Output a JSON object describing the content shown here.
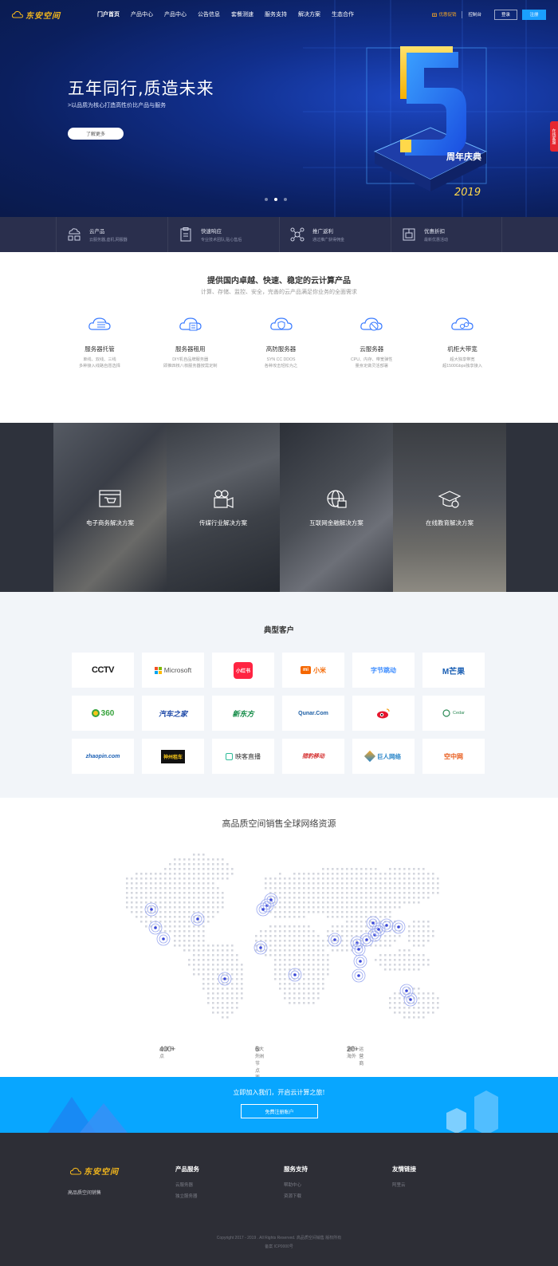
{
  "nav": {
    "logo_text": "东安空间",
    "items": [
      "门户首页",
      "产品中心",
      "产品中心",
      "公告信息",
      "套餐测速",
      "服务支持",
      "解决方案",
      "生态合作"
    ],
    "promo": "优惠促销",
    "console": "控制台",
    "login": "登录",
    "register": "注册"
  },
  "hero": {
    "title": "五年同行,质造未来",
    "subtitle": ">以品质为核心打造高性价比产品与服务",
    "button": "了解更多",
    "badge_year": "2019",
    "badge_text": "周年庆典",
    "side_tag": "在线客服"
  },
  "strip": [
    {
      "title": "云产品",
      "desc": "云服务器,虚机,网服器",
      "icon": "cloud-product-icon"
    },
    {
      "title": "快速响应",
      "desc": "专业技术团队,贴心售后",
      "icon": "fast-response-icon"
    },
    {
      "title": "推广返利",
      "desc": "通过推广获得佣金",
      "icon": "promotion-icon"
    },
    {
      "title": "优惠折扣",
      "desc": "最新优惠活动",
      "icon": "discount-icon"
    }
  ],
  "products": {
    "title": "提供国内卓越、快速、稳定的云计算产品",
    "subtitle": "计算、存储、监控、安全，完善的云产品满足你业务的全面需求",
    "items": [
      {
        "name": "服务器托管",
        "desc1": "单线、双线、三线",
        "desc2": "多种接入线路自愿选择",
        "icon": "cloud-hosting-icon"
      },
      {
        "name": "服务器租用",
        "desc1": "DIY机自品牌服务器",
        "desc2": "即推四核八核服务器按需定制",
        "icon": "cloud-server-rent-icon"
      },
      {
        "name": "高防服务器",
        "desc1": "SYN CC DDOS",
        "desc2": "各种攻击轻松为之",
        "icon": "cloud-shield-icon"
      },
      {
        "name": "云服务器",
        "desc1": "CPU、内存、带宽弹性",
        "desc2": "量身定做灵活部署",
        "icon": "cloud-server-icon"
      },
      {
        "name": "机柜大带宽",
        "desc1": "超大独享带宽",
        "desc2": "超1500Gbps独享接入",
        "icon": "cloud-cabinet-icon"
      }
    ]
  },
  "solutions": [
    {
      "name": "电子商务解决方案",
      "icon": "ecommerce-icon"
    },
    {
      "name": "传媒行业解决方案",
      "icon": "media-camera-icon"
    },
    {
      "name": "互联网金融解决方案",
      "icon": "globe-finance-icon"
    },
    {
      "name": "在线教育解决方案",
      "icon": "graduation-cap-icon"
    }
  ],
  "clients": {
    "title": "典型客户",
    "logos": [
      {
        "name": "CCTV",
        "color": "#d11f26"
      },
      {
        "name": "Microsoft",
        "color": "#555555"
      },
      {
        "name": "小红书",
        "color": "#ffffff"
      },
      {
        "name": "小米",
        "color": "#f56700"
      },
      {
        "name": "字节跳动",
        "color": "#3c8cff"
      },
      {
        "name": "M芒果",
        "color": "#1a5fb4"
      },
      {
        "name": "360",
        "color": "#38a43d"
      },
      {
        "name": "汽车之家",
        "color": "#1f4aa8"
      },
      {
        "name": "新东方",
        "color": "#118a45"
      },
      {
        "name": "Qunar.Com",
        "color": "#1d5fa5"
      },
      {
        "name": "微博",
        "color": "#e6162d"
      },
      {
        "name": "Cedar",
        "color": "#2e8b57"
      },
      {
        "name": "zhaopin.com",
        "color": "#1a5fb4"
      },
      {
        "name": "神州租车",
        "color": "#f5c518"
      },
      {
        "name": "映客直播",
        "color": "#2ebc99"
      },
      {
        "name": "猎豹移动",
        "color": "#d42c2c"
      },
      {
        "name": "巨人网络",
        "color": "#2a86c9"
      },
      {
        "name": "空中网",
        "color": "#e85a1a"
      }
    ]
  },
  "map": {
    "title": "高品质空间销售全球网络资源",
    "stats": [
      {
        "label": "全球节点",
        "value": "400+"
      },
      {
        "label": "海外节点覆盖",
        "value": "6",
        "suffix": "大洲"
      },
      {
        "label": "遍布海外",
        "value": "20+",
        "suffix": "运营商"
      }
    ]
  },
  "cta": {
    "text": "立即加入我们，开启云计算之旅!",
    "button": "免费注册账户"
  },
  "footer": {
    "logo_text": "东安空间",
    "slogan": "高品质空间销售",
    "columns": [
      {
        "title": "产品服务",
        "links": [
          "云服务器",
          "独立服务器"
        ]
      },
      {
        "title": "服务支持",
        "links": [
          "帮助中心",
          "资源下载"
        ]
      },
      {
        "title": "友情链接",
        "links": [
          "阿里云"
        ]
      }
    ],
    "copyright": "Copyright 2017 - 2019 . All Rights Reserved. 高品质空间销售 版权所有",
    "icp": "备案 ICP0000号"
  }
}
